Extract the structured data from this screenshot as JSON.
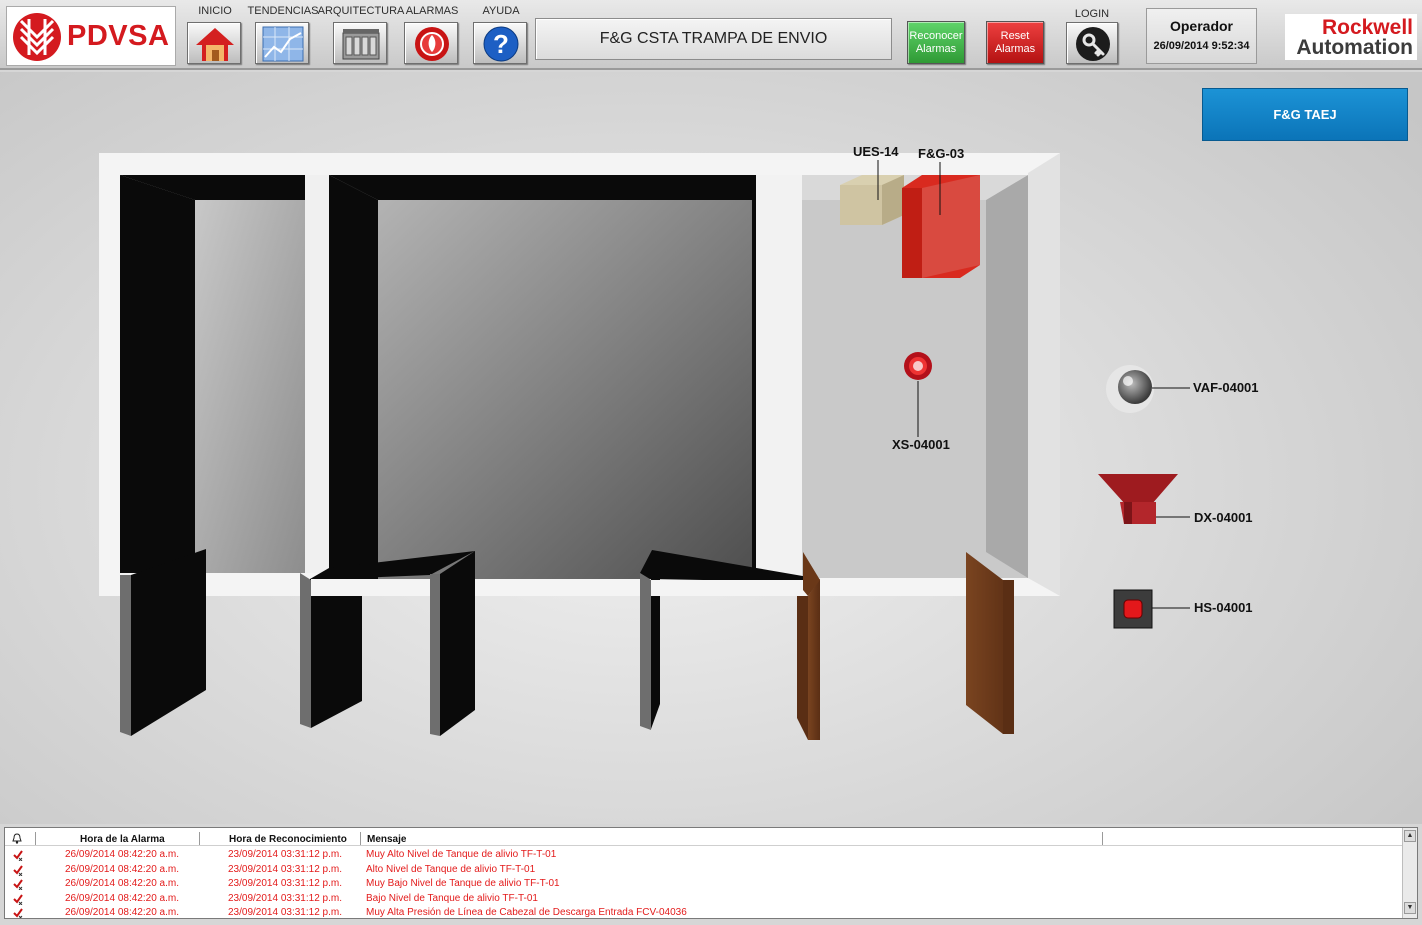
{
  "header": {
    "brand": "PDVSA",
    "nav": [
      {
        "label": "INICIO",
        "icon": "home-icon"
      },
      {
        "label": "TENDENCIAS",
        "icon": "trend-chart-icon"
      },
      {
        "label": "ARQUITECTURA",
        "icon": "plc-rack-icon"
      },
      {
        "label": "ALARMAS",
        "icon": "alarm-siren-icon"
      },
      {
        "label": "AYUDA",
        "icon": "help-icon"
      }
    ],
    "screen_title": "F&G CSTA TRAMPA DE ENVIO",
    "ack_alarms": "Reconocer Alarmas",
    "reset_alarms": "Reset Alarmas",
    "login_label": "LOGIN",
    "user": "Operador",
    "datetime": "26/09/2014 9:52:34",
    "vendor_line1": "Rockwell",
    "vendor_line2": "Automation"
  },
  "main": {
    "area_button": "F&G TAEJ",
    "devices": {
      "ues": "UES-14",
      "fg_panel": "F&G-03",
      "xs": "XS-04001",
      "vaf": "VAF-04001",
      "dx": "DX-04001",
      "hs": "HS-04001"
    }
  },
  "alarms": {
    "columns": [
      "Hora de la Alarma",
      "Hora de Reconocimiento",
      "Mensaje"
    ],
    "rows": [
      {
        "alarm_time": "26/09/2014 08:42:20 a.m.",
        "ack_time": "23/09/2014 03:31:12 p.m.",
        "message": "Muy Alto Nivel de Tanque de alivio TF-T-01"
      },
      {
        "alarm_time": "26/09/2014 08:42:20 a.m.",
        "ack_time": "23/09/2014 03:31:12 p.m.",
        "message": "Alto Nivel de Tanque de alivio TF-T-01"
      },
      {
        "alarm_time": "26/09/2014 08:42:20 a.m.",
        "ack_time": "23/09/2014 03:31:12 p.m.",
        "message": "Muy Bajo Nivel de Tanque de alivio TF-T-01"
      },
      {
        "alarm_time": "26/09/2014 08:42:20 a.m.",
        "ack_time": "23/09/2014 03:31:12 p.m.",
        "message": "Bajo Nivel de Tanque de alivio TF-T-01"
      },
      {
        "alarm_time": "26/09/2014 08:42:20 a.m.",
        "ack_time": "23/09/2014 03:31:12 p.m.",
        "message": "Muy Alta Presión de Línea de Cabezal de Descarga Entrada FCV-04036"
      }
    ],
    "text_color": "#e31b1b"
  },
  "colors": {
    "brand_red": "#d41a1f",
    "ack_green": "#3fae45",
    "reset_red": "#c81a1a",
    "area_blue": "#0b7fc7"
  }
}
